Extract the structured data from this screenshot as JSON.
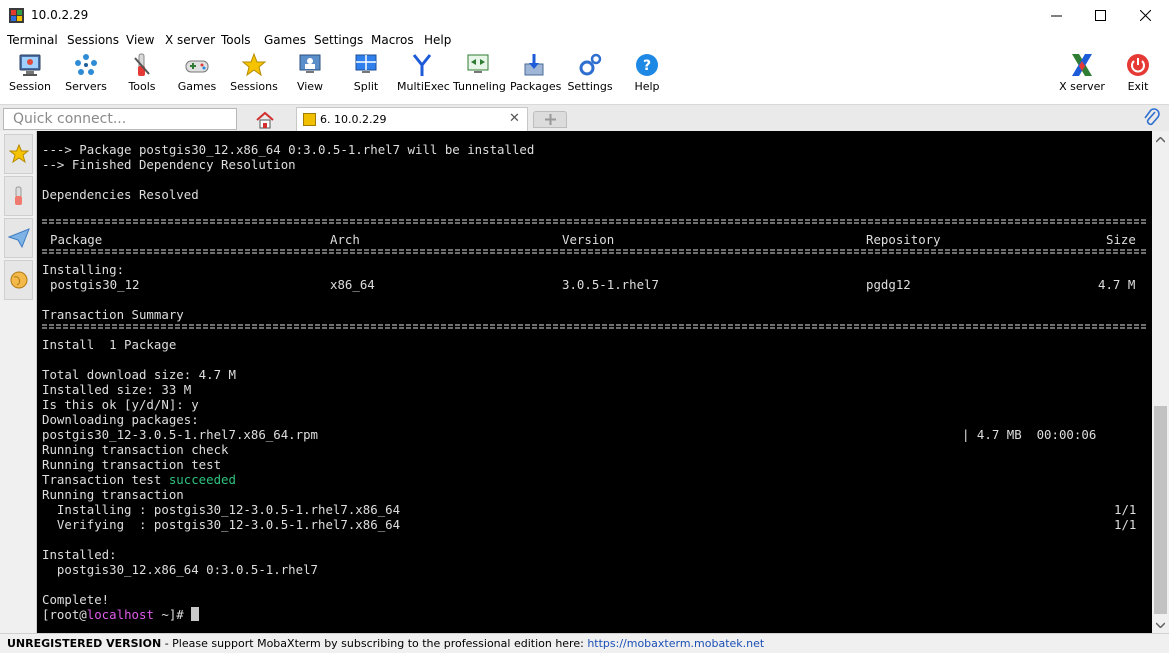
{
  "window": {
    "title": "10.0.2.29"
  },
  "menu": [
    "Terminal",
    "Sessions",
    "View",
    "X server",
    "Tools",
    "Games",
    "Settings",
    "Macros",
    "Help"
  ],
  "toolbar": {
    "left": [
      {
        "label": "Session",
        "icon": "session-icon"
      },
      {
        "label": "Servers",
        "icon": "servers-icon"
      },
      {
        "label": "Tools",
        "icon": "tools-icon"
      },
      {
        "label": "Games",
        "icon": "games-icon"
      },
      {
        "label": "Sessions",
        "icon": "sessions-star-icon"
      },
      {
        "label": "View",
        "icon": "view-icon"
      },
      {
        "label": "Split",
        "icon": "split-icon"
      },
      {
        "label": "MultiExec",
        "icon": "multiexec-icon"
      },
      {
        "label": "Tunneling",
        "icon": "tunneling-icon"
      },
      {
        "label": "Packages",
        "icon": "packages-icon"
      },
      {
        "label": "Settings",
        "icon": "settings-icon"
      },
      {
        "label": "Help",
        "icon": "help-icon"
      }
    ],
    "xserver_label": "X server",
    "exit_label": "Exit"
  },
  "quick_connect": {
    "placeholder": "Quick connect..."
  },
  "tab": {
    "label": "6. 10.0.2.29",
    "close": "✕"
  },
  "terminal": {
    "lines_top": [
      "---> Package postgis30_12.x86_64 0:3.0.5-1.rhel7 will be installed",
      "--> Finished Dependency Resolution",
      "",
      "Dependencies Resolved"
    ],
    "table_header": {
      "package": "Package",
      "arch": "Arch",
      "version": "Version",
      "repository": "Repository",
      "size": "Size"
    },
    "installing_label": "Installing:",
    "row": {
      "package": "postgis30_12",
      "arch": "x86_64",
      "version": "3.0.5-1.rhel7",
      "repository": "pgdg12",
      "size": "4.7 M"
    },
    "transaction_summary": "Transaction Summary",
    "install_line": "Install  1 Package",
    "total_download": "Total download size: 4.7 M",
    "installed_size": "Installed size: 33 M",
    "confirm": "Is this ok [y/d/N]: y",
    "downloading": "Downloading packages:",
    "rpm_file": "postgis30_12-3.0.5-1.rhel7.x86_64.rpm",
    "rpm_progress": "| 4.7 MB  00:00:06",
    "check": "Running transaction check",
    "test": "Running transaction test",
    "test_result_prefix": "Transaction test ",
    "test_result_word": "succeeded",
    "running": "Running transaction",
    "installing_step": "  Installing : postgis30_12-3.0.5-1.rhel7.x86_64",
    "installing_count": "1/1",
    "verifying_step": "  Verifying  : postgis30_12-3.0.5-1.rhel7.x86_64",
    "verifying_count": "1/1",
    "installed_label": "Installed:",
    "installed_pkg": "  postgis30_12.x86_64 0:3.0.5-1.rhel7",
    "complete": "Complete!",
    "prompt_open": "[root@",
    "prompt_host": "localhost",
    "prompt_close": " ~]# "
  },
  "status": {
    "unregistered": "UNREGISTERED VERSION",
    "message": "  -  Please support MobaXterm by subscribing to the professional edition here:  ",
    "link": "https://mobaxterm.mobatek.net"
  }
}
